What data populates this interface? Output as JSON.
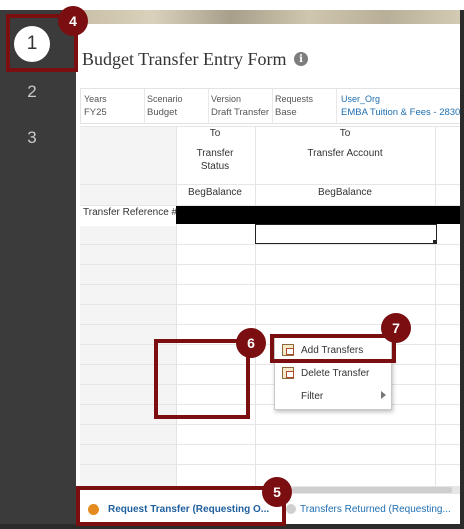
{
  "steps": [
    "1",
    "2",
    "3"
  ],
  "form": {
    "title": "Budget Transfer Entry Form",
    "info_icon": "i"
  },
  "pov": [
    {
      "label": "Years",
      "value": "FY25",
      "link": false
    },
    {
      "label": "Scenario",
      "value": "Budget",
      "link": false
    },
    {
      "label": "Version",
      "value": "Draft Transfer",
      "link": false
    },
    {
      "label": "Requests",
      "value": "Base",
      "link": false
    },
    {
      "label": "User_Org",
      "value": "EMBA Tuition & Fees - 2830",
      "link": true
    }
  ],
  "grid": {
    "col1_top": "To",
    "col2_top": "To",
    "col1_header": "Transfer Status",
    "col1_header_line1": "Transfer",
    "col1_header_line2": "Status",
    "col2_header": "Transfer Account",
    "col1_sub": "BegBalance",
    "col2_sub": "BegBalance",
    "row_label": "Transfer Reference #"
  },
  "context_menu": {
    "items": [
      {
        "label": "Add Transfers",
        "icon": "add-transfers-icon",
        "submenu": false
      },
      {
        "label": "Delete Transfer",
        "icon": "delete-transfer-icon",
        "submenu": false
      },
      {
        "label": "Filter",
        "icon": "",
        "submenu": true
      }
    ]
  },
  "tabs": [
    {
      "label": "Request Transfer (Requesting O...",
      "active": true
    },
    {
      "label": "Transfers Returned (Requesting...",
      "active": false
    }
  ],
  "annotations": {
    "badges": [
      "4",
      "5",
      "6",
      "7"
    ]
  },
  "colors": {
    "annotation": "#7a0e10",
    "rail": "#3b3b3b",
    "link": "#1f6fb2",
    "active_dot": "#e58a1f"
  }
}
